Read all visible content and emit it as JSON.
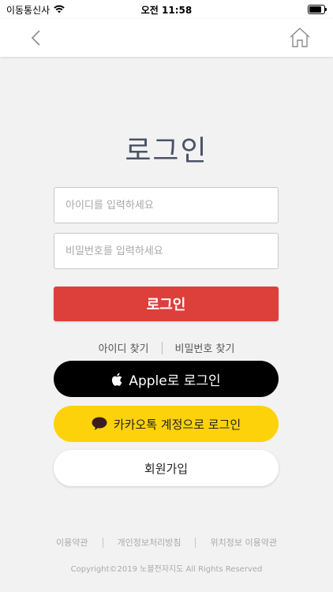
{
  "status_bar": {
    "carrier": "이동통신사",
    "time": "오전 11:58",
    "battery_level": 0.95
  },
  "nav": {
    "back_icon": "chevron-left-icon",
    "home_icon": "home-icon"
  },
  "login": {
    "title": "로그인",
    "id_placeholder": "아이디를 입력하세요",
    "id_value": "",
    "pw_placeholder": "비밀번호를 입력하세요",
    "pw_value": "",
    "submit_label": "로그인",
    "find_id_label": "아이디 찾기",
    "find_pw_label": "비밀번호 찾기",
    "apple_label": "Apple로 로그인",
    "kakao_label": "카카오톡 계정으로 로그인",
    "signup_label": "회원가입"
  },
  "footer": {
    "links": [
      "이용약관",
      "개인정보처리방침",
      "위치정보 이용약관"
    ],
    "copyright": "Copyright©2019 노블전자지도 All Rights Reserved"
  },
  "colors": {
    "login_button": "#dd3f3a",
    "apple_button": "#000000",
    "kakao_button": "#fdd20a"
  }
}
